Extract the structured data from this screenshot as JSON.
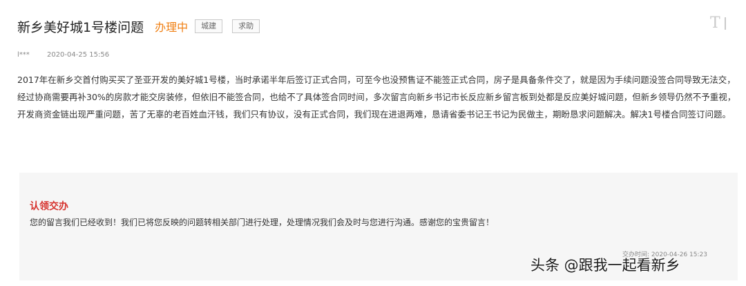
{
  "post": {
    "title": "新乡美好城1号楼问题",
    "status": "办理中",
    "tags": [
      "城建",
      "求助"
    ],
    "author": "l***",
    "date": "2020-04-25 15:56",
    "content": "2017年在新乡交首付购买买了圣亚开发的美好城1号楼，当时承诺半年后签订正式合同，可至今也没预售证不能签正式合同，房子是具备条件交了，就是因为手续问题没签合同导致无法交，经过协商需要再补30%的房款才能交房装修，但依旧不能签合同，也给不了具体签合同时间，多次留言向新乡书记市长反应新乡留言板到处都是反应美好城问题，但新乡领导仍然不予重视，开发商资金链出现严重问题，苦了无辜的老百姓血汗钱，我们只有协议，没有正式合同，我们现在进退两难，恳请省委书记王书记为民做主，期盼恳求问题解决。解决1号楼合同签订问题。"
  },
  "toolbar": {
    "font_size_glyph": "T"
  },
  "reply": {
    "title": "认领交办",
    "text": "您的留言我们已经收到！我们已将您反映的问题转相关部门进行处理，处理情况我们会及时与您进行沟通。感谢您的宝贵留言！",
    "time": "交办时间: 2020-04-26 15:23"
  },
  "watermark": "头条 @跟我一起看新乡",
  "colors": {
    "status": "#f07f12",
    "reply_title": "#d6322d",
    "reply_bg": "#f6f6f6"
  }
}
